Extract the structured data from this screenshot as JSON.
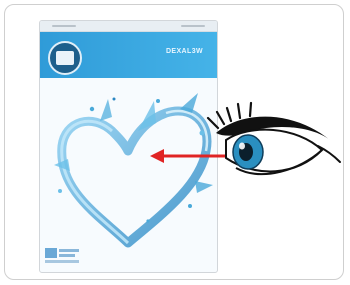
{
  "illustration": {
    "pouch": {
      "brand_label": "DEXAL3W",
      "badge_text": "",
      "bottom_logo_text": "",
      "graphic": "splash-heart"
    },
    "eye": {
      "icon": "eye-icon"
    },
    "arrow": {
      "icon": "arrow-left-icon",
      "color": "#e02424"
    },
    "colors": {
      "band": "#2f9bd8",
      "water": "#4aa9d9",
      "iris": "#2a8fc0"
    }
  }
}
